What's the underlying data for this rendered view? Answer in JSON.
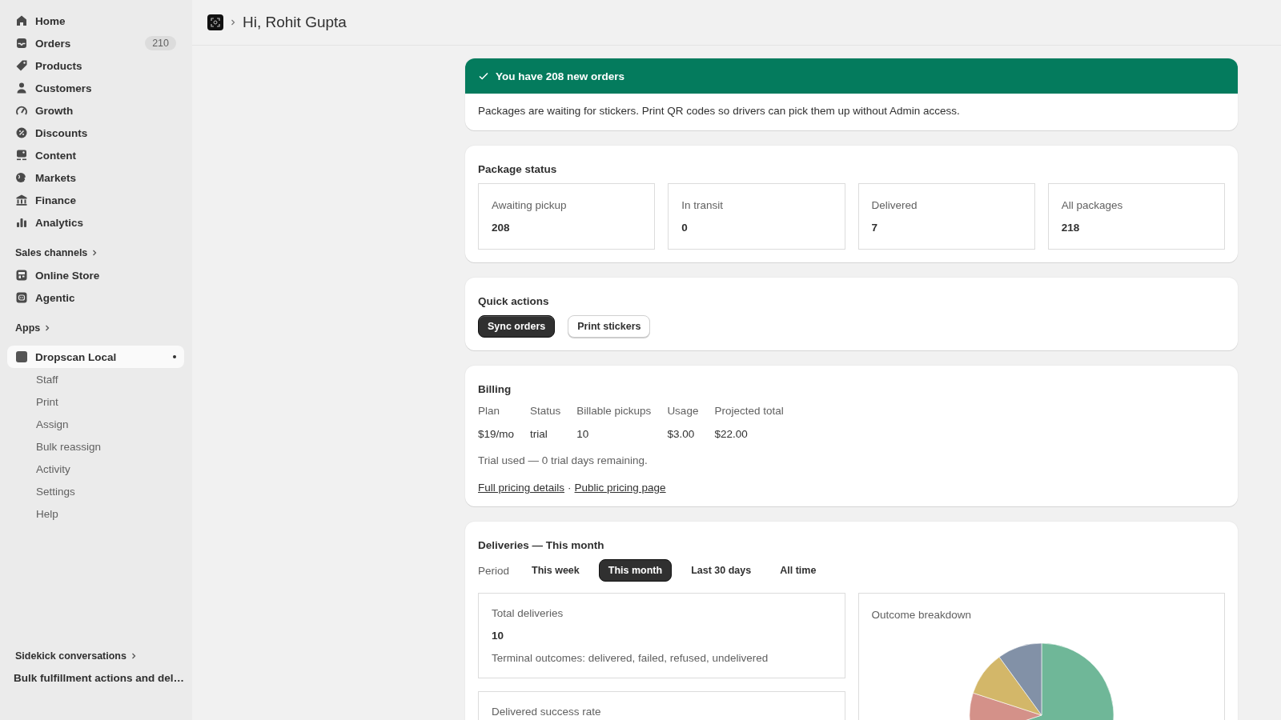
{
  "sidebar": {
    "items": [
      {
        "label": "Home"
      },
      {
        "label": "Orders",
        "badge": "210"
      },
      {
        "label": "Products"
      },
      {
        "label": "Customers"
      },
      {
        "label": "Growth"
      },
      {
        "label": "Discounts"
      },
      {
        "label": "Content"
      },
      {
        "label": "Markets"
      },
      {
        "label": "Finance"
      },
      {
        "label": "Analytics"
      }
    ],
    "sales_channels": {
      "heading": "Sales channels",
      "items": [
        {
          "label": "Online Store"
        },
        {
          "label": "Agentic"
        }
      ]
    },
    "apps": {
      "heading": "Apps",
      "app": {
        "label": "Dropscan Local",
        "selected": true,
        "pinned": true,
        "children": [
          {
            "label": "Staff",
            "selected": false
          },
          {
            "label": "Print",
            "selected": false
          },
          {
            "label": "Assign",
            "selected": false
          },
          {
            "label": "Bulk reassign",
            "selected": false
          },
          {
            "label": "Activity",
            "selected": false
          },
          {
            "label": "Settings",
            "selected": false
          },
          {
            "label": "Help",
            "selected": false
          }
        ]
      }
    },
    "sidekick": {
      "heading": "Sidekick conversations",
      "items": [
        "Bulk fulfillment actions and del…"
      ]
    }
  },
  "header": {
    "title": "Hi, Rohit Gupta"
  },
  "banner": {
    "title": "You have 208 new orders",
    "body": "Packages are waiting for stickers. Print QR codes so drivers can pick them up without Admin access."
  },
  "package_status": {
    "title": "Package status",
    "tiles": [
      {
        "label": "Awaiting pickup",
        "value": "208"
      },
      {
        "label": "In transit",
        "value": "0"
      },
      {
        "label": "Delivered",
        "value": "7"
      },
      {
        "label": "All packages",
        "value": "218"
      }
    ]
  },
  "quick_actions": {
    "title": "Quick actions",
    "buttons": [
      {
        "label": "Sync orders",
        "kind": "primary"
      },
      {
        "label": "Print stickers",
        "kind": "secondary"
      }
    ]
  },
  "billing": {
    "title": "Billing",
    "columns": [
      "Plan",
      "Status",
      "Billable pickups",
      "Usage",
      "Projected total"
    ],
    "values": [
      "$19/mo",
      "trial",
      "10",
      "$3.00",
      "$22.00"
    ],
    "note": "Trial used — 0 trial days remaining.",
    "links": [
      "Full pricing details",
      "Public pricing page"
    ],
    "separator": "·"
  },
  "deliveries": {
    "title": "Deliveries — This month",
    "period_label": "Period",
    "periods": [
      {
        "label": "This week",
        "selected": false
      },
      {
        "label": "This month",
        "selected": true
      },
      {
        "label": "Last 30 days",
        "selected": false
      },
      {
        "label": "All time",
        "selected": false
      }
    ],
    "total": {
      "label": "Total deliveries",
      "value": "10",
      "note": "Terminal outcomes: delivered, failed, refused, undelivered"
    },
    "success_rate": {
      "label": "Delivered success rate"
    },
    "breakdown": {
      "title": "Outcome breakdown",
      "kind": "picture"
    }
  }
}
